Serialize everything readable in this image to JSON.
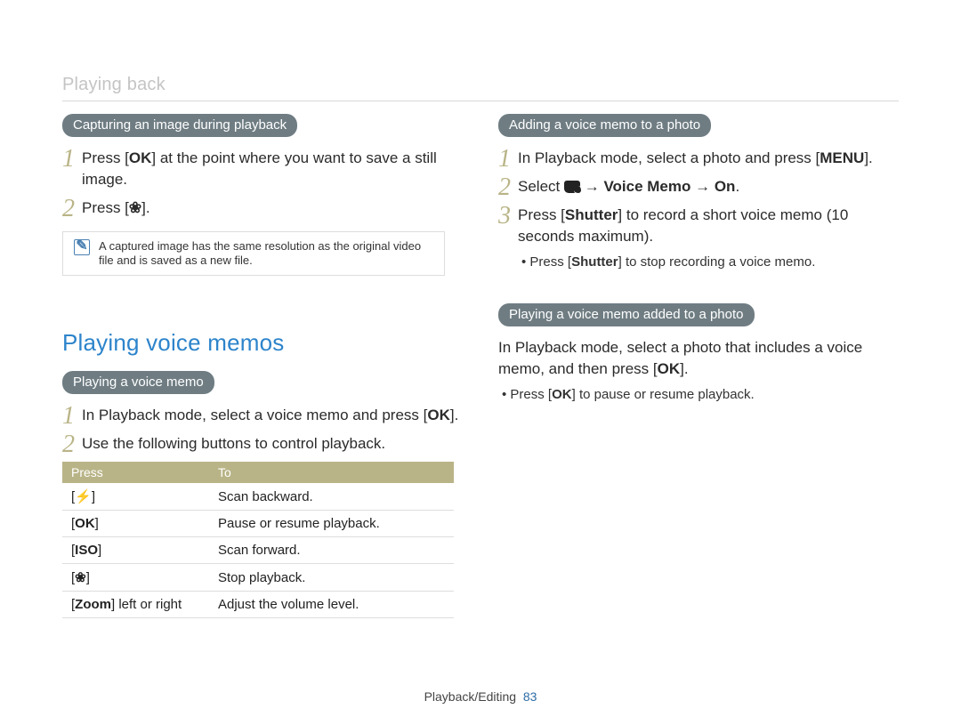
{
  "breadcrumb": "Playing back",
  "left": {
    "pill1": "Capturing an image during playback",
    "step1": {
      "num": "1",
      "pre": "Press [",
      "btn": "OK",
      "post": "] at the point where you want to save a still image."
    },
    "step2": {
      "num": "2",
      "pre": "Press [",
      "glyph": "❀",
      "post": "]."
    },
    "note": "A captured image has the same resolution as the original video file and is saved as a new file.",
    "section_title": "Playing voice memos",
    "pill2": "Playing a voice memo",
    "pvm_step1": {
      "num": "1",
      "pre": "In Playback mode, select a voice memo and press [",
      "btn": "OK",
      "post": "]."
    },
    "pvm_step2": {
      "num": "2",
      "text": "Use the following buttons to control playback."
    },
    "table": {
      "headers": [
        "Press",
        "To"
      ],
      "rows": [
        {
          "press_l": "[",
          "press_icon": "⚡",
          "press_r": "]",
          "to": "Scan backward."
        },
        {
          "press_l": "[",
          "press_bold": "OK",
          "press_r": "]",
          "to": "Pause or resume playback."
        },
        {
          "press_l": "[",
          "press_bold": "ISO",
          "press_r": "]",
          "to": "Scan forward."
        },
        {
          "press_l": "[",
          "press_icon": "❀",
          "press_r": "]",
          "to": "Stop playback."
        },
        {
          "press_zoom_l": "[",
          "press_zoom_b": "Zoom",
          "press_zoom_r": "] left or right",
          "to": "Adjust the volume level."
        }
      ]
    }
  },
  "right": {
    "pill1": "Adding a voice memo to a photo",
    "step1": {
      "num": "1",
      "pre": "In Playback mode, select a photo and press [",
      "btn": "MENU",
      "post": "]."
    },
    "step2": {
      "num": "2",
      "pre": "Select ",
      "arrow1": " → ",
      "b1": "Voice Memo",
      "arrow2": " → ",
      "b2": "On",
      "post": "."
    },
    "step3": {
      "num": "3",
      "pre": "Press [",
      "b": "Shutter",
      "post": "] to record a short voice memo (10 seconds maximum)."
    },
    "sub": {
      "pre": "• Press [",
      "b": "Shutter",
      "post": "] to stop recording a voice memo."
    },
    "pill2": "Playing a voice memo added to a photo",
    "para": {
      "pre": "In Playback mode, select a photo that includes a voice memo, and then press [",
      "btn": "OK",
      "post": "]."
    },
    "sub2": {
      "pre": "• Press [",
      "btn": "OK",
      "post": "] to pause or resume playback."
    }
  },
  "footer": {
    "section": "Playback/Editing",
    "page": "83"
  },
  "chart_data": {
    "type": "table",
    "title": "Voice memo playback controls",
    "columns": [
      "Press",
      "To"
    ],
    "rows": [
      [
        "[bolt-icon]",
        "Scan backward."
      ],
      [
        "[OK]",
        "Pause or resume playback."
      ],
      [
        "[ISO]",
        "Scan forward."
      ],
      [
        "[flower-icon]",
        "Stop playback."
      ],
      [
        "[Zoom] left or right",
        "Adjust the volume level."
      ]
    ]
  }
}
